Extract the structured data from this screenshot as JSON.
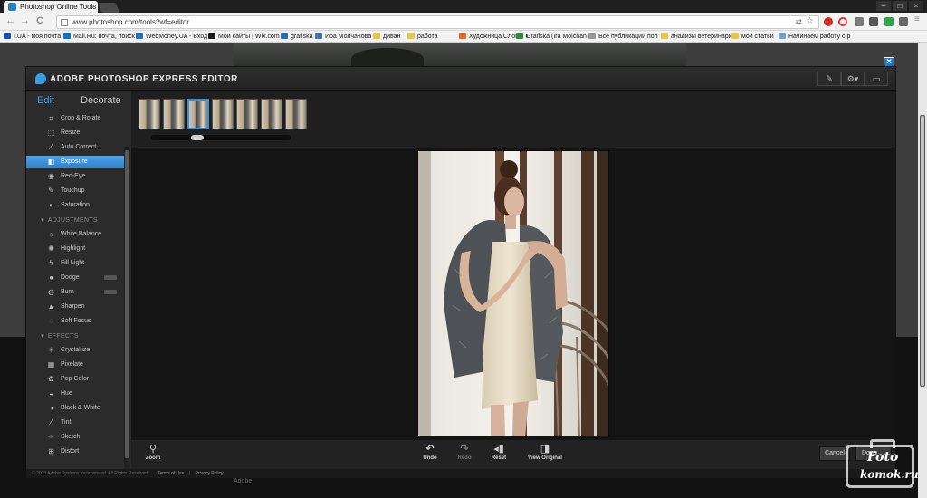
{
  "browser": {
    "tab_title": "Photoshop Online Tools",
    "tab_close": "×",
    "url": "www.photoshop.com/tools?wf=editor",
    "nav_back": "←",
    "nav_forward": "→",
    "nav_reload": "C",
    "win_min": "–",
    "win_max": "□",
    "win_close": "×"
  },
  "bookmarks": [
    {
      "label": "I.UA - моя почта",
      "color": "#1d4fa8"
    },
    {
      "label": "Mail.Ru: почта, поиск",
      "color": "#1572c9"
    },
    {
      "label": "WebMoney.UA - Вход",
      "color": "#2a6fba"
    },
    {
      "label": "Мои сайты | Wix.com",
      "color": "#1a1a1a"
    },
    {
      "label": "grafiska",
      "color": "#2b6cb2"
    },
    {
      "label": "Ира Молчанова",
      "color": "#4a76a8"
    },
    {
      "label": "диван",
      "color": "#e8c44a"
    },
    {
      "label": "работа",
      "color": "#e8c44a"
    },
    {
      "label": "Художница Слова: к",
      "color": "#e06a2a"
    },
    {
      "label": "Grafiska (Ira Molchan",
      "color": "#2e8b3e"
    },
    {
      "label": "Все публикации пол",
      "color": "#999999"
    },
    {
      "label": "анализы ветеринари",
      "color": "#e8c44a"
    },
    {
      "label": "мои статьи",
      "color": "#e8c44a"
    },
    {
      "label": "Начинаем работу с р",
      "color": "#7a9fc9"
    }
  ],
  "editor": {
    "title": "ADOBE PHOTOSHOP EXPRESS EDITOR",
    "toolbar": [
      "✎",
      "⚙▾",
      "▭"
    ],
    "modes": {
      "edit": "Edit",
      "decorate": "Decorate"
    },
    "basic_tools": [
      {
        "label": "Crop & Rotate",
        "icon": "⌗"
      },
      {
        "label": "Resize",
        "icon": "⬚"
      },
      {
        "label": "Auto Correct",
        "icon": "⁄"
      },
      {
        "label": "Exposure",
        "icon": "◧",
        "active": true
      },
      {
        "label": "Red-Eye",
        "icon": "◉"
      },
      {
        "label": "Touchup",
        "icon": "✎"
      },
      {
        "label": "Saturation",
        "icon": "◐"
      }
    ],
    "adjustments_label": "ADJUSTMENTS",
    "adjustment_tools": [
      {
        "label": "White Balance",
        "icon": "☼"
      },
      {
        "label": "Highlight",
        "icon": "✺"
      },
      {
        "label": "Fill Light",
        "icon": "ϟ"
      },
      {
        "label": "Dodge",
        "icon": "●",
        "badge": true
      },
      {
        "label": "Burn",
        "icon": "◍",
        "badge": true
      },
      {
        "label": "Sharpen",
        "icon": "▲"
      },
      {
        "label": "Soft Focus",
        "icon": "◌"
      }
    ],
    "effects_label": "EFFECTS",
    "effect_tools": [
      {
        "label": "Crystallize",
        "icon": "✳"
      },
      {
        "label": "Pixelate",
        "icon": "▦"
      },
      {
        "label": "Pop Color",
        "icon": "✿"
      },
      {
        "label": "Hue",
        "icon": "◒"
      },
      {
        "label": "Black & White",
        "icon": "◑"
      },
      {
        "label": "Tint",
        "icon": "⁄"
      },
      {
        "label": "Sketch",
        "icon": "✑"
      },
      {
        "label": "Distort",
        "icon": "⊞"
      }
    ],
    "thumbnail_count": 7,
    "selected_thumbnail": 3,
    "bottom": {
      "zoom": "Zoom",
      "undo": "Undo",
      "redo": "Redo",
      "reset": "Reset",
      "view_original": "View Original",
      "cancel": "Cancel",
      "done": "Done"
    },
    "footer": {
      "copyright": "© 2013 Adobe Systems Incorporated. All Rights Reserved.",
      "terms": "Terms of Use",
      "privacy": "Privacy Policy"
    }
  },
  "page_footer_text": "Adobe",
  "watermark": {
    "line1": "Foto",
    "line2": "komok.ru"
  }
}
